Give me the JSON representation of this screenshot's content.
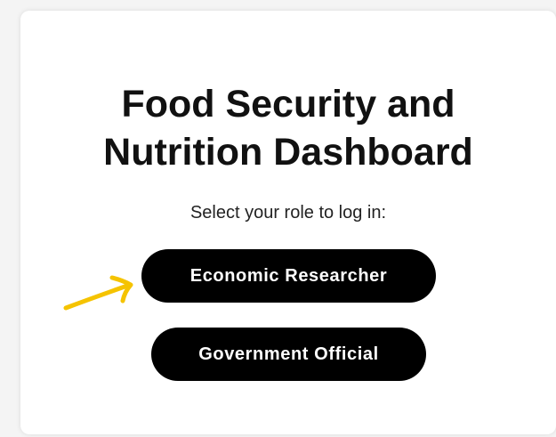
{
  "login": {
    "title_line1": "Food Security and",
    "title_line2": "Nutrition Dashboard",
    "subtitle": "Select your role to log in:",
    "roles": [
      {
        "label": "Economic Researcher"
      },
      {
        "label": "Government Official"
      }
    ]
  },
  "annotation": {
    "icon": "arrow-right-icon",
    "color": "#f5c300"
  },
  "colors": {
    "button_bg": "#000000",
    "button_text": "#ffffff",
    "card_bg": "#ffffff",
    "page_bg": "#f4f4f4"
  }
}
